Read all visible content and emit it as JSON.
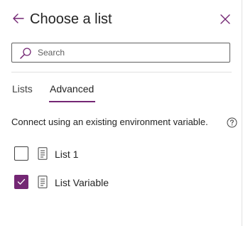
{
  "header": {
    "title": "Choose a list",
    "back_icon": "arrow-left-icon",
    "close_icon": "close-icon"
  },
  "search": {
    "placeholder": "Search",
    "value": "",
    "icon": "search-icon"
  },
  "tabs": [
    {
      "label": "Lists",
      "selected": false
    },
    {
      "label": "Advanced",
      "selected": true
    }
  ],
  "advanced": {
    "description": "Connect using an existing environment variable.",
    "help_icon": "help-circle-icon",
    "items": [
      {
        "label": "List 1",
        "checked": false,
        "icon": "list-icon"
      },
      {
        "label": "List Variable",
        "checked": true,
        "icon": "list-icon"
      }
    ]
  },
  "colors": {
    "accent": "#742774",
    "text": "#242424",
    "border": "#616161",
    "divider": "#e1e1e1"
  }
}
